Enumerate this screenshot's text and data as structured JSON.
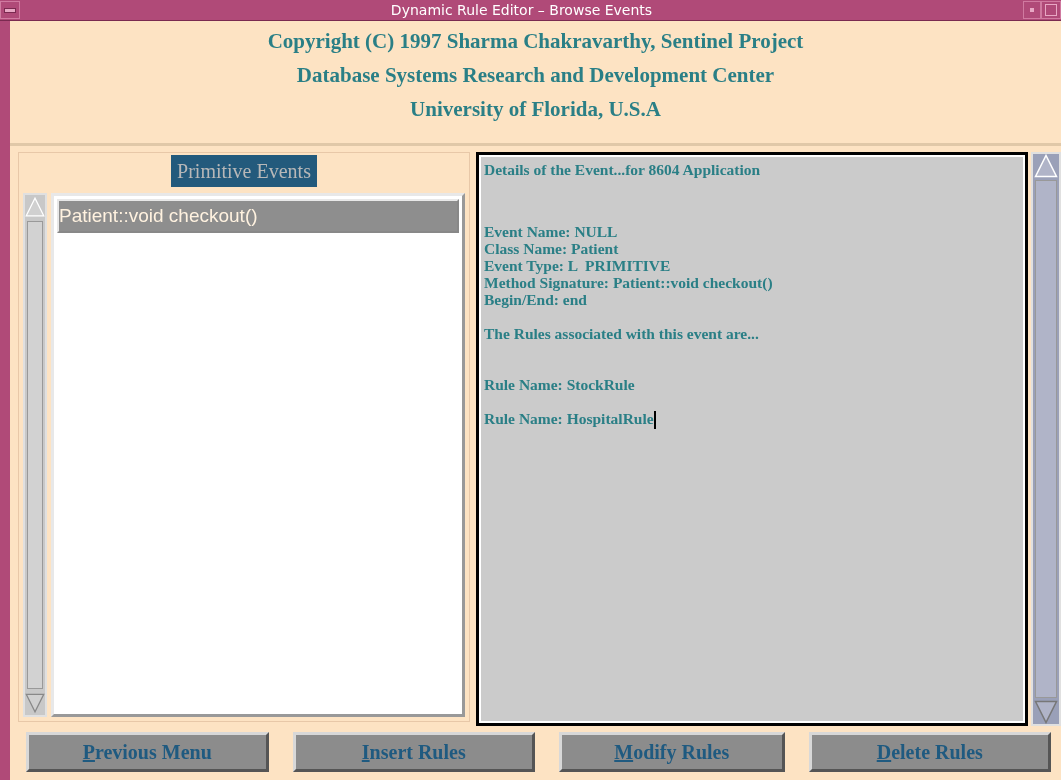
{
  "window": {
    "title": "Dynamic Rule Editor – Browse Events"
  },
  "header": [
    "Copyright (C) 1997 Sharma Chakravarthy, Sentinel Project",
    "Database Systems Research and Development Center",
    "University of Florida, U.S.A"
  ],
  "events_panel": {
    "title": "Primitive Events",
    "items": [
      {
        "label": "Patient::void checkout()",
        "selected": true
      }
    ]
  },
  "details": {
    "cursor_visible": true,
    "paragraphs": [
      {
        "kind": "heading",
        "lines": [
          "Details of the Event...for 8604 Application"
        ]
      },
      {
        "kind": "body",
        "lines": [
          "Event Name: NULL",
          "Class Name: Patient",
          "Event Type: L  PRIMITIVE",
          "Method Signature: Patient::void checkout()",
          "Begin/End: end"
        ]
      },
      {
        "kind": "heading",
        "lines": [
          "The Rules associated with this event are..."
        ]
      },
      {
        "kind": "body",
        "lines": [
          "Rule Name: StockRule"
        ]
      },
      {
        "kind": "body",
        "lines": [
          "Rule Name: HospitalRule"
        ]
      }
    ]
  },
  "buttons": [
    {
      "label": "Previous Menu"
    },
    {
      "label": "Insert Rules"
    },
    {
      "label": "Modify Rules"
    },
    {
      "label": "Delete Rules"
    }
  ]
}
